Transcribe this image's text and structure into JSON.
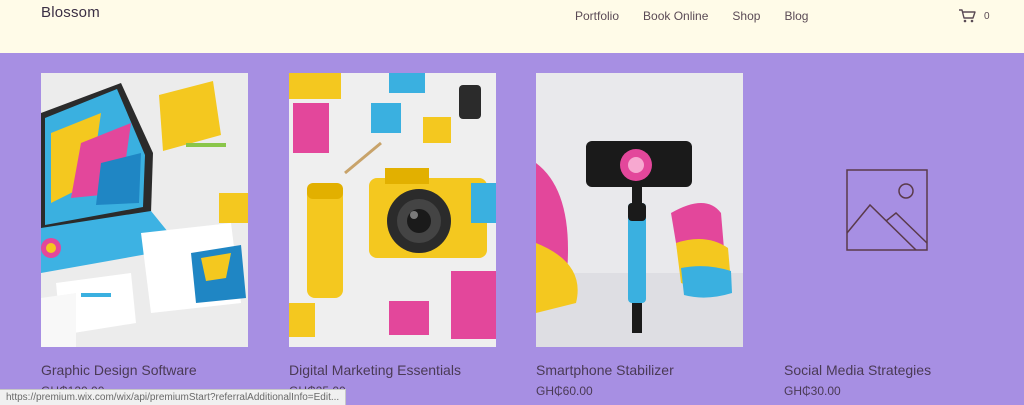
{
  "header": {
    "logo": "Blossom",
    "nav": [
      "Portfolio",
      "Book Online",
      "Shop",
      "Blog"
    ],
    "cart_count": "0"
  },
  "products": [
    {
      "name": "Graphic Design Software",
      "price": "GH₵120.00",
      "image": "laptop-and-stationery-mockup"
    },
    {
      "name": "Digital Marketing Essentials",
      "price": "GH₵25.00",
      "image": "yellow-camera-flatlay"
    },
    {
      "name": "Smartphone Stabilizer",
      "price": "GH₵60.00",
      "image": "phone-on-gimbal-stabilizer"
    },
    {
      "name": "Social Media Strategies",
      "price": "GH₵30.00",
      "image": "image-placeholder-icon"
    }
  ],
  "status_bar": {
    "url": "https://premium.wix.com/wix/api/premiumStart?referralAdditionalInfo=Edit..."
  },
  "colors": {
    "header_bg": "#fffbe8",
    "page_bg": "#a78fe3",
    "text": "#4a3a55"
  }
}
